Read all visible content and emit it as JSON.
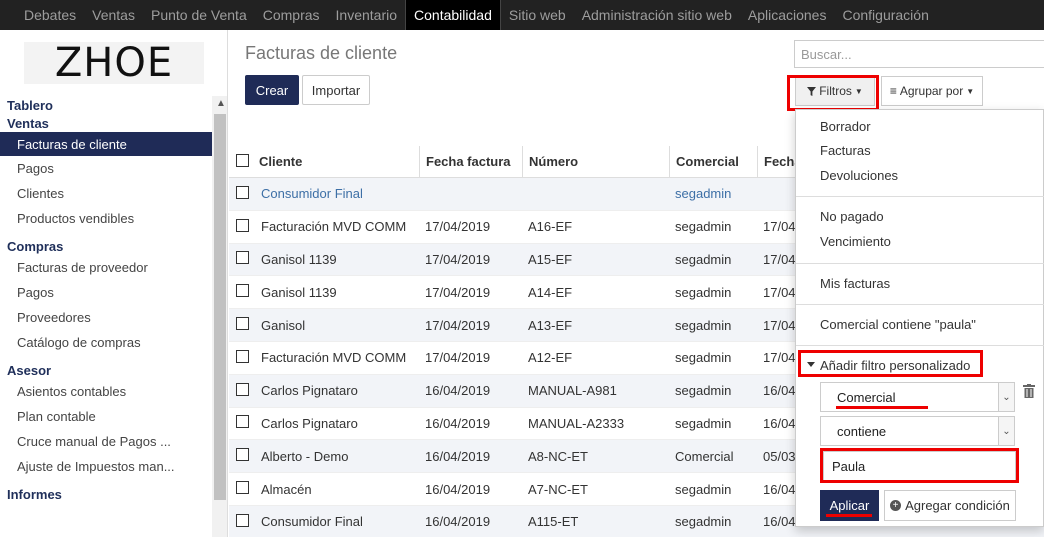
{
  "topnav": [
    "Debates",
    "Ventas",
    "Punto de Venta",
    "Compras",
    "Inventario",
    "Contabilidad",
    "Sitio web",
    "Administración sitio web",
    "Aplicaciones",
    "Configuración"
  ],
  "active_nav_index": 5,
  "logo_text": "ZHOE",
  "sidebar": {
    "sections": [
      {
        "label": "Tablero",
        "items": []
      },
      {
        "label": "Ventas",
        "items": [
          "Facturas de cliente",
          "Pagos",
          "Clientes",
          "Productos vendibles"
        ]
      },
      {
        "label": "Compras",
        "items": [
          "Facturas de proveedor",
          "Pagos",
          "Proveedores",
          "Catálogo de compras"
        ]
      },
      {
        "label": "Asesor",
        "items": [
          "Asientos contables",
          "Plan contable",
          "Cruce manual de Pagos ...",
          "Ajuste de Impuestos man..."
        ]
      },
      {
        "label": "Informes",
        "items": []
      }
    ],
    "active_item": "Facturas de cliente"
  },
  "main": {
    "title": "Facturas de cliente",
    "create_label": "Crear",
    "import_label": "Importar",
    "search_placeholder": "Buscar...",
    "filters_label": "Filtros",
    "groupby_label": "Agrupar por"
  },
  "table": {
    "headers": [
      "Cliente",
      "Fecha factura",
      "Número",
      "Comercial",
      "Fecha"
    ],
    "rows": [
      [
        "Consumidor Final",
        "",
        "",
        "segadmin",
        ""
      ],
      [
        "Facturación MVD COMM",
        "17/04/2019",
        "A16-EF",
        "segadmin",
        "17/04"
      ],
      [
        "Ganisol 1139",
        "17/04/2019",
        "A15-EF",
        "segadmin",
        "17/04"
      ],
      [
        "Ganisol 1139",
        "17/04/2019",
        "A14-EF",
        "segadmin",
        "17/04"
      ],
      [
        "Ganisol",
        "17/04/2019",
        "A13-EF",
        "segadmin",
        "17/04"
      ],
      [
        "Facturación MVD COMM",
        "17/04/2019",
        "A12-EF",
        "segadmin",
        "17/04"
      ],
      [
        "Carlos Pignataro",
        "16/04/2019",
        "MANUAL-A981",
        "segadmin",
        "16/04"
      ],
      [
        "Carlos Pignataro",
        "16/04/2019",
        "MANUAL-A2333",
        "segadmin",
        "16/04"
      ],
      [
        "Alberto - Demo",
        "16/04/2019",
        "A8-NC-ET",
        "Comercial",
        "05/03"
      ],
      [
        "Almacén",
        "16/04/2019",
        "A7-NC-ET",
        "segadmin",
        "16/04"
      ],
      [
        "Consumidor Final",
        "16/04/2019",
        "A115-ET",
        "segadmin",
        "16/04"
      ]
    ]
  },
  "filters_dropdown": {
    "group1": [
      "Borrador",
      "Facturas",
      "Devoluciones"
    ],
    "group2": [
      "No pagado",
      "Vencimiento"
    ],
    "group3": [
      "Mis facturas"
    ],
    "group4": [
      "Comercial contiene \"paula\""
    ],
    "custom_label": "Añadir filtro personalizado",
    "field_value": "Comercial",
    "operator_value": "contiene",
    "value_input": "Paula",
    "apply_label": "Aplicar",
    "add_condition_label": "Agregar condición"
  }
}
